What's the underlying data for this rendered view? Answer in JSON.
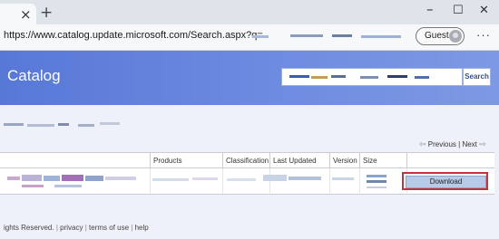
{
  "browser": {
    "tab_close": "×",
    "new_tab": "+",
    "window_controls": {
      "minimize": "–",
      "maximize": "☐",
      "close": "✕"
    },
    "url": "https://www.catalog.update.microsoft.com/Search.aspx?q=",
    "profile_label": "Guest",
    "more_menu": "···"
  },
  "header": {
    "title": "Catalog",
    "search_button": "Search"
  },
  "pagination": {
    "previous": "Previous",
    "separator": "|",
    "next": "Next"
  },
  "table": {
    "columns": [
      "Products",
      "Classification",
      "Last Updated",
      "Version",
      "Size"
    ],
    "download_label": "Download"
  },
  "footer": {
    "rights_text": "ights Reserved.",
    "links": [
      "privacy",
      "terms of use",
      "help"
    ],
    "separator": "|"
  }
}
